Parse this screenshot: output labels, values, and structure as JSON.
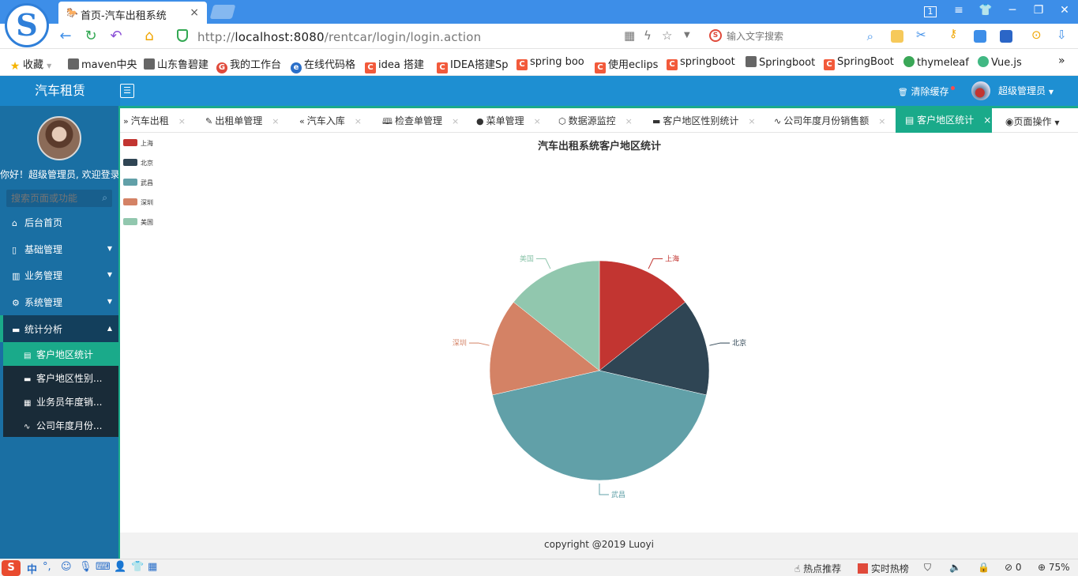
{
  "browser": {
    "tab_title": "首页-汽车出租系统",
    "tab_close": "×",
    "url_prefix": "http://",
    "url_host": "localhost:8080",
    "url_path": "/rentcar/login/login.action",
    "search_placeholder": "输入文字搜索",
    "window_min": "─",
    "window_max": "❐",
    "window_close": "✕"
  },
  "bookmarks": [
    {
      "label": "收藏",
      "color": "#f5b400"
    },
    {
      "label": "maven中央",
      "color": "#555555"
    },
    {
      "label": "山东鲁碧建",
      "color": "#555555"
    },
    {
      "label": "我的工作台",
      "color": "#e04a3b"
    },
    {
      "label": "在线代码格",
      "color": "#2a6fc9"
    },
    {
      "label": "idea 搭建",
      "color": "#f25a3b"
    },
    {
      "label": "IDEA搭建Sp",
      "color": "#f25a3b"
    },
    {
      "label": "spring boo",
      "color": "#f25a3b"
    },
    {
      "label": "使用eclips",
      "color": "#f25a3b"
    },
    {
      "label": "springboot",
      "color": "#f25a3b"
    },
    {
      "label": "Springboot",
      "color": "#555555"
    },
    {
      "label": "SpringBoot",
      "color": "#f25a3b"
    },
    {
      "label": "thymeleaf",
      "color": "#3aa757"
    },
    {
      "label": "Vue.js",
      "color": "#41b883"
    }
  ],
  "header": {
    "app_title": "汽车租赁",
    "clear_cache": "清除缓存",
    "user_name": "超级管理员"
  },
  "sidebar": {
    "welcome": "你好！超级管理员, 欢迎登录",
    "search_placeholder": "搜索页面或功能",
    "items": [
      {
        "label": "后台首页",
        "icon": "home-icon"
      },
      {
        "label": "基础管理",
        "icon": "file-icon"
      },
      {
        "label": "业务管理",
        "icon": "columns-icon"
      },
      {
        "label": "系统管理",
        "icon": "gear-icon"
      },
      {
        "label": "统计分析",
        "icon": "chart-icon"
      }
    ],
    "sub_items": [
      {
        "label": "客户地区统计"
      },
      {
        "label": "客户地区性别..."
      },
      {
        "label": "业务员年度销..."
      },
      {
        "label": "公司年度月份..."
      }
    ]
  },
  "tabs": [
    {
      "label": "汽车出租"
    },
    {
      "label": "出租单管理"
    },
    {
      "label": "汽车入库"
    },
    {
      "label": "检查单管理"
    },
    {
      "label": "菜单管理"
    },
    {
      "label": "数据源监控"
    },
    {
      "label": "客户地区性别统计"
    },
    {
      "label": "公司年度月份销售额"
    },
    {
      "label": "客户地区统计"
    }
  ],
  "tab_close": "×",
  "page_ops": "页面操作",
  "chart_data": {
    "type": "pie",
    "title": "汽车出租系统客户地区统计",
    "legend_position": "top-left",
    "series": [
      {
        "name": "上海",
        "value": 1,
        "color": "#c23531"
      },
      {
        "name": "北京",
        "value": 1,
        "color": "#2f4554"
      },
      {
        "name": "武昌",
        "value": 3,
        "color": "#61a0a8"
      },
      {
        "name": "深圳",
        "value": 1,
        "color": "#d48265"
      },
      {
        "name": "美国",
        "value": 1,
        "color": "#91c7ae"
      }
    ]
  },
  "footer": "copyright @2019 Luoyi",
  "statusbar": {
    "ime_mode": "中",
    "hot_recommend": "热点推荐",
    "realtime_hot": "实时热榜",
    "counter": "0",
    "zoom": "75%"
  }
}
